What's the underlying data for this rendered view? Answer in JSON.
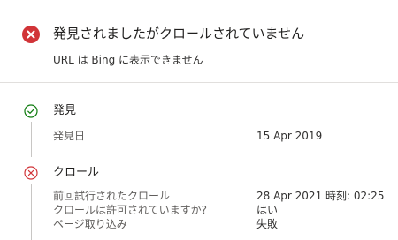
{
  "header": {
    "status_icon": "error-circle-icon",
    "title": "発見されましたがクロールされていません",
    "subtitle": "URL は Bing に表示できません"
  },
  "sections": {
    "discovery": {
      "icon": "check-circle-icon",
      "title": "発見",
      "rows": [
        {
          "label": "発見日",
          "value": "15 Apr 2019"
        }
      ]
    },
    "crawl": {
      "icon": "error-circle-outline-icon",
      "title": "クロール",
      "rows": [
        {
          "label": "前回試行されたクロール",
          "value": "28 Apr 2021 時刻: 02:25"
        },
        {
          "label": "クロールは許可されていますか?",
          "value": "はい"
        },
        {
          "label": "ページ取り込み",
          "value": "失敗"
        }
      ]
    }
  },
  "colors": {
    "error": "#d13438",
    "success": "#107c10",
    "divider": "#e1dfdd"
  }
}
